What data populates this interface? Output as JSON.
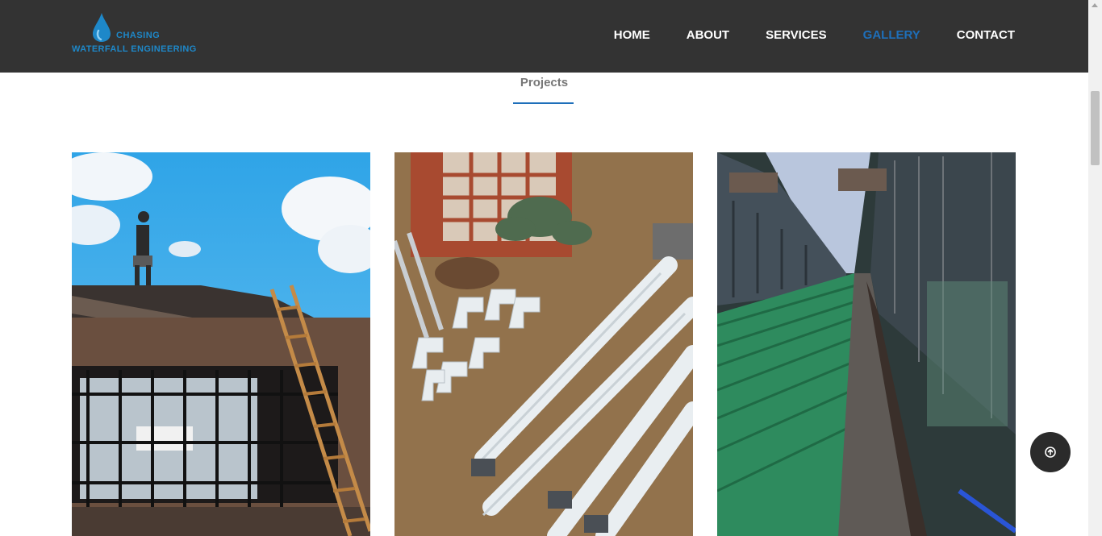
{
  "brand": {
    "line1": "CHASING",
    "line2": "WATERFALL ENGINEERING",
    "color": "#1e88c9",
    "icon": "water-drop-icon"
  },
  "nav": {
    "items": [
      {
        "label": "HOME",
        "active": false
      },
      {
        "label": "ABOUT",
        "active": false
      },
      {
        "label": "SERVICES",
        "active": false
      },
      {
        "label": "GALLERY",
        "active": true
      },
      {
        "label": "CONTACT",
        "active": false
      }
    ],
    "active_color": "#1e6fba"
  },
  "section": {
    "title": "Projects"
  },
  "gallery": {
    "items": [
      {
        "subject": "worker on roof with ladder"
      },
      {
        "subject": "white downpipes and gutter bends on grass"
      },
      {
        "subject": "green metal roof with gutter"
      }
    ]
  },
  "back_to_top": {
    "icon": "arrow-up-circle-icon"
  },
  "colors": {
    "header_bg": "#333333",
    "accent": "#1e6fba"
  }
}
